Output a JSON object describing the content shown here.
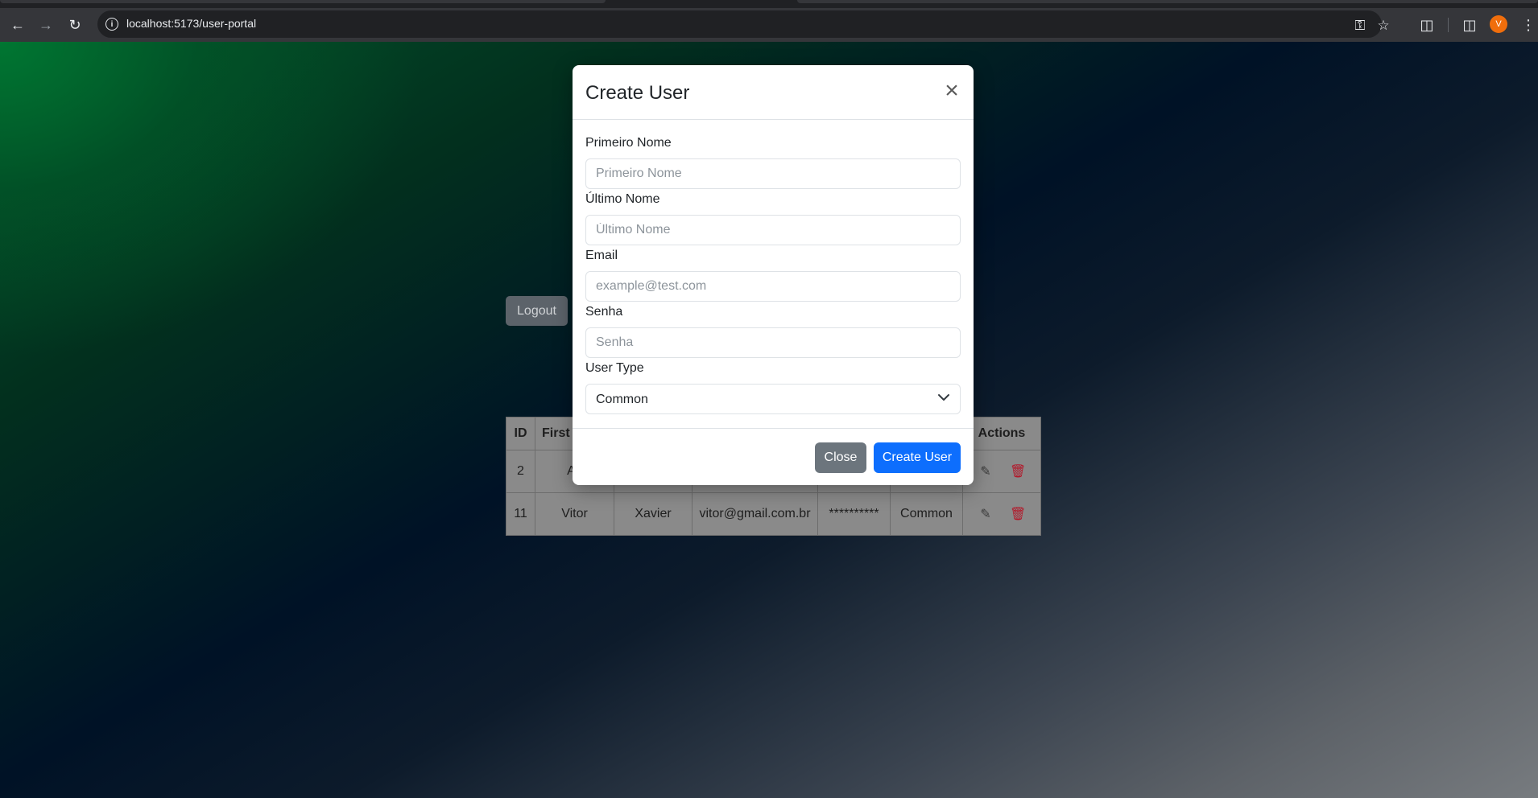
{
  "browser": {
    "url": "localhost:5173/user-portal",
    "profile_initial": "V",
    "profile_color": "#f06e0c"
  },
  "page": {
    "logout_label": "Logout",
    "table": {
      "headers": [
        "ID",
        "First N",
        "",
        "",
        "",
        "",
        "Actions"
      ],
      "rows": [
        {
          "id": "2",
          "first": "Ac",
          "last": "",
          "email": "",
          "password": "",
          "type": ""
        },
        {
          "id": "11",
          "first": "Vitor",
          "last": "Xavier",
          "email": "vitor@gmail.com.br",
          "password": "**********",
          "type": "Common"
        }
      ]
    }
  },
  "modal": {
    "title": "Create User",
    "fields": {
      "first_name": {
        "label": "Primeiro Nome",
        "placeholder": "Primeiro Nome",
        "value": ""
      },
      "last_name": {
        "label": "Último Nome",
        "placeholder": "Último Nome",
        "value": ""
      },
      "email": {
        "label": "Email",
        "placeholder": "example@test.com",
        "value": ""
      },
      "password": {
        "label": "Senha",
        "placeholder": "Senha",
        "value": ""
      },
      "user_type": {
        "label": "User Type",
        "selected": "Common"
      }
    },
    "close_label": "Close",
    "submit_label": "Create User"
  },
  "colors": {
    "primary": "#0d6efd",
    "secondary": "#6c757d",
    "danger": "#b3182a"
  }
}
